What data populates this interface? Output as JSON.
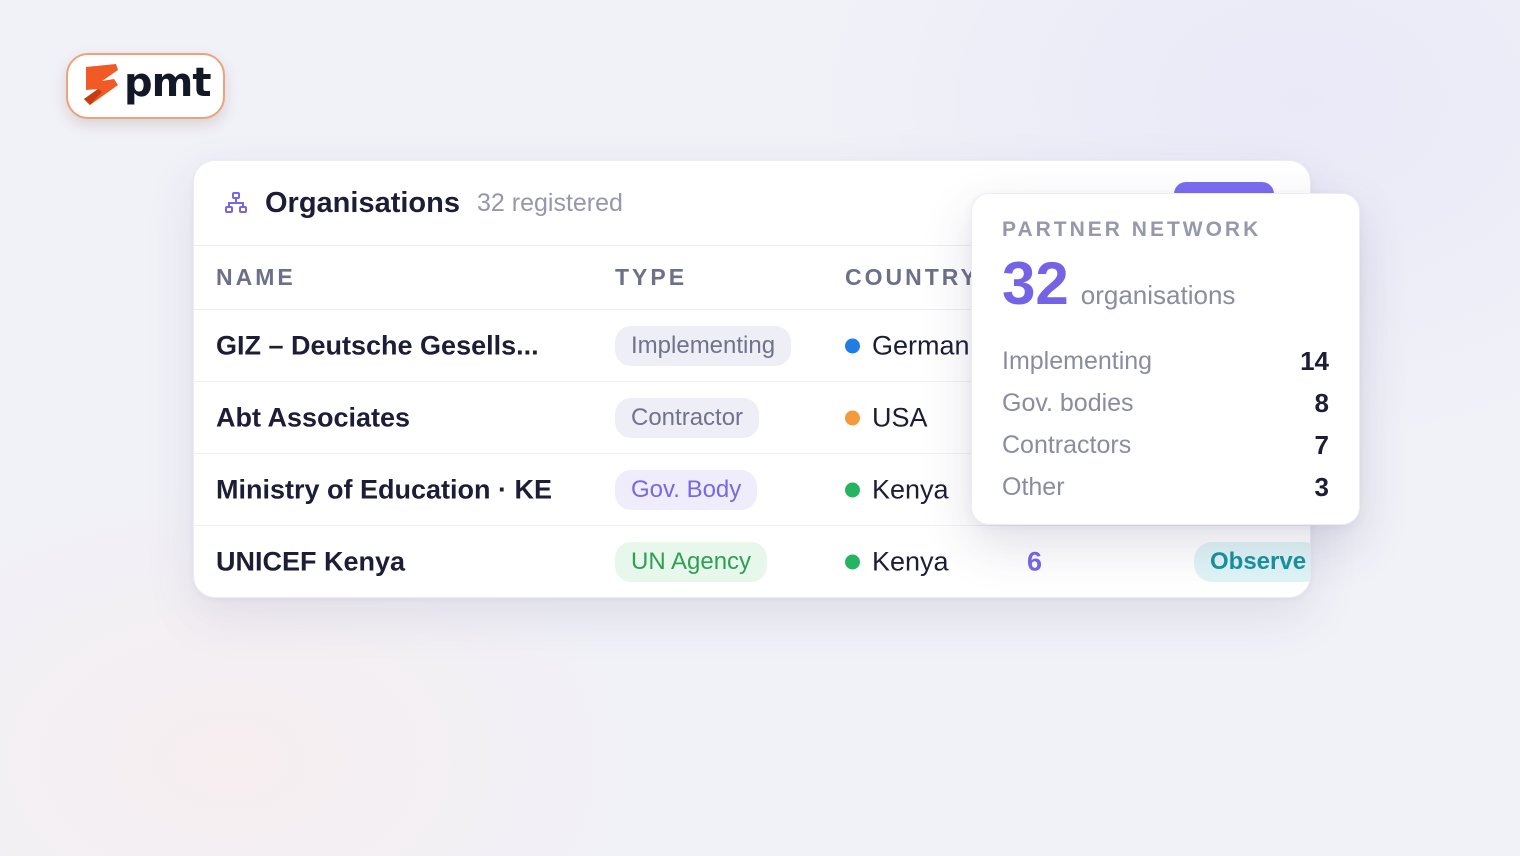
{
  "logo": {
    "text": "pmt"
  },
  "card": {
    "title": "Organisations",
    "subtitle": "32 registered",
    "columns": [
      "NAME",
      "TYPE",
      "COUNTRY"
    ],
    "rows": [
      {
        "name": "GIZ – Deutsche Gesells...",
        "type": "Implementing",
        "type_style": "gray",
        "country": "German",
        "country_dot": "#1f7de3",
        "count": "",
        "role": ""
      },
      {
        "name": "Abt Associates",
        "type": "Contractor",
        "type_style": "gray",
        "country": "USA",
        "country_dot": "#f39a3c",
        "count": "",
        "role": ""
      },
      {
        "name": "Ministry of Education · KE",
        "type": "Gov. Body",
        "type_style": "violet",
        "country": "Kenya",
        "country_dot": "#25b561",
        "count": "",
        "role": ""
      },
      {
        "name": "UNICEF Kenya",
        "type": "UN Agency",
        "type_style": "green",
        "country": "Kenya",
        "country_dot": "#25b561",
        "count": "6",
        "role": "Observe"
      }
    ]
  },
  "popover": {
    "label": "PARTNER NETWORK",
    "total": "32",
    "total_unit": "organisations",
    "breakdown": [
      {
        "label": "Implementing",
        "value": "14"
      },
      {
        "label": "Gov. bodies",
        "value": "8"
      },
      {
        "label": "Contractors",
        "value": "7"
      },
      {
        "label": "Other",
        "value": "3"
      }
    ]
  },
  "colors": {
    "accent": "#7563e6",
    "brand_orange": "#f15a24"
  },
  "icons": [
    "org-structure-icon",
    "pmt-logo-icon"
  ]
}
